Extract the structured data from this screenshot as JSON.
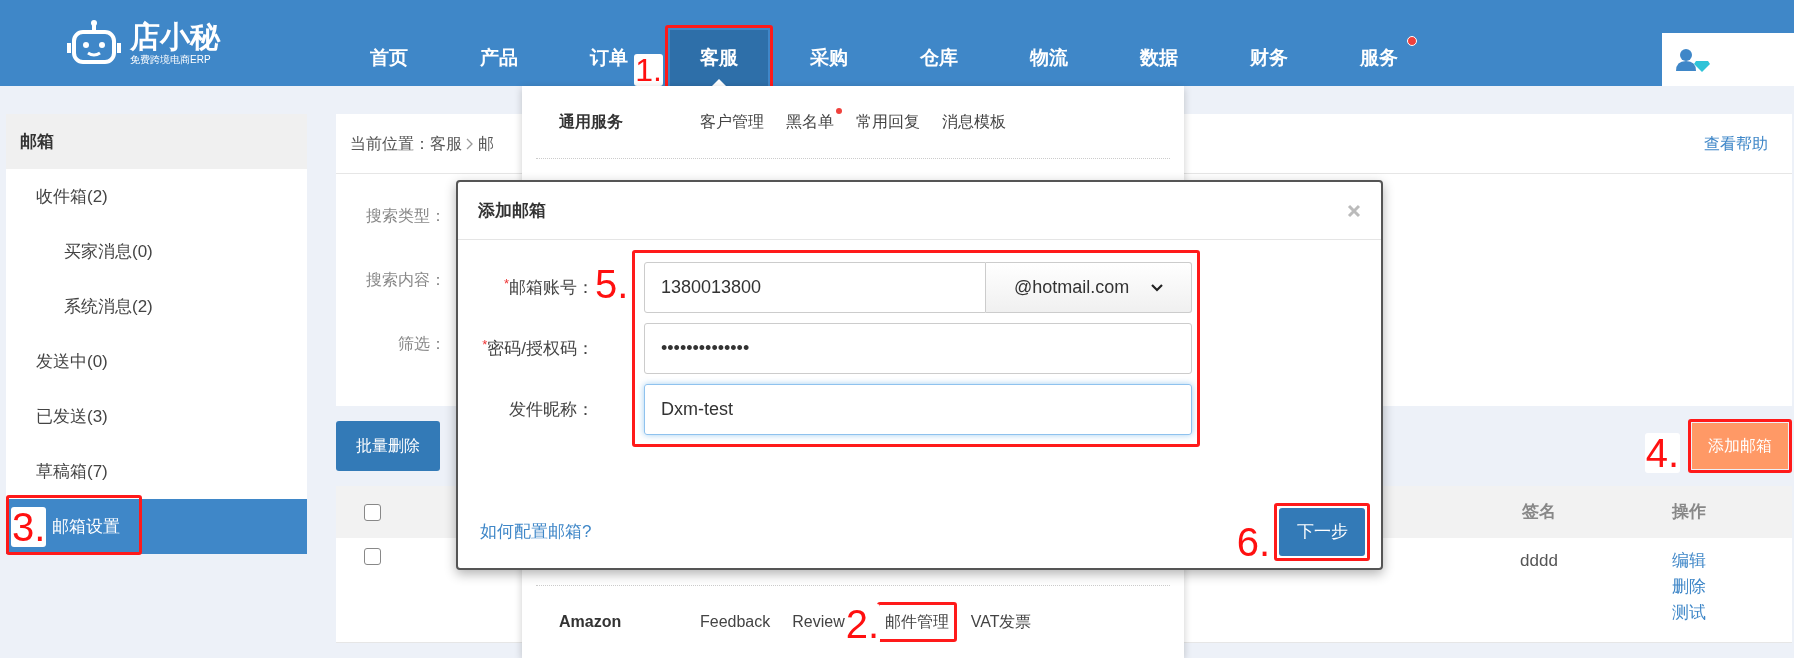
{
  "logo": {
    "name": "店小秘",
    "tagline": "免费跨境电商ERP"
  },
  "nav": [
    {
      "label": "首页",
      "selected": false,
      "dot": false
    },
    {
      "label": "产品",
      "selected": false,
      "dot": false
    },
    {
      "label": "订单",
      "selected": false,
      "dot": false
    },
    {
      "label": "客服",
      "selected": true,
      "dot": false,
      "step": "1."
    },
    {
      "label": "采购",
      "selected": false,
      "dot": false
    },
    {
      "label": "仓库",
      "selected": false,
      "dot": false
    },
    {
      "label": "物流",
      "selected": false,
      "dot": false
    },
    {
      "label": "数据",
      "selected": false,
      "dot": false
    },
    {
      "label": "财务",
      "selected": false,
      "dot": false
    },
    {
      "label": "服务",
      "selected": false,
      "dot": true
    }
  ],
  "dropdown": {
    "groups": [
      {
        "title": "通用服务",
        "items": [
          {
            "label": "客户管理",
            "dot": false
          },
          {
            "label": "黑名单",
            "dot": true
          },
          {
            "label": "常用回复",
            "dot": false
          },
          {
            "label": "消息模板",
            "dot": false
          }
        ]
      },
      {
        "title": "Amazon",
        "items": [
          {
            "label": "Feedback",
            "dot": false
          },
          {
            "label": "Review",
            "dot": false
          },
          {
            "label": "邮件管理",
            "dot": false,
            "step": "2."
          },
          {
            "label": "VAT发票",
            "dot": false
          }
        ]
      }
    ]
  },
  "sidebar": {
    "title": "邮箱",
    "items": [
      {
        "label": "收件箱(2)",
        "selected": false,
        "children": [
          {
            "label": "买家消息(0)",
            "selected": false
          },
          {
            "label": "系统消息(2)",
            "selected": false
          }
        ]
      },
      {
        "label": "发送中(0)",
        "selected": false
      },
      {
        "label": "已发送(3)",
        "selected": false
      },
      {
        "label": "草稿箱(7)",
        "selected": false
      },
      {
        "label": "邮箱设置",
        "selected": true,
        "step": "3."
      }
    ]
  },
  "breadcrumb": {
    "prefix": "当前位置：",
    "items": [
      "客服",
      "邮"
    ]
  },
  "help_link": "查看帮助",
  "search": {
    "fields": [
      {
        "label": "搜索类型："
      },
      {
        "label": "搜索内容："
      },
      {
        "label": "筛选："
      }
    ]
  },
  "toolbar": {
    "bulk_delete": "批量删除",
    "add_button": {
      "label": "添加邮箱",
      "step": "4."
    }
  },
  "table": {
    "header_checked": false,
    "columns": [
      "签名",
      "操作"
    ],
    "rows": [
      {
        "checked": false,
        "signature": "dddd",
        "actions": [
          "编辑",
          "删除",
          "测试"
        ]
      }
    ]
  },
  "modal": {
    "title": "添加邮箱",
    "required_mark": "*",
    "step": "5.",
    "fields": [
      {
        "kind": "email",
        "label": "邮箱账号：",
        "required": true,
        "focused": false,
        "value": "1380013800",
        "domain": "@hotmail.com"
      },
      {
        "kind": "password",
        "label": "密码/授权码：",
        "required": true,
        "focused": false,
        "value": "••••••••••••••"
      },
      {
        "kind": "text",
        "label": "发件昵称：",
        "required": false,
        "focused": true,
        "value": "Dxm-test"
      }
    ],
    "help_link": "如何配置邮箱?",
    "next_button": {
      "label": "下一步",
      "step": "6."
    }
  }
}
